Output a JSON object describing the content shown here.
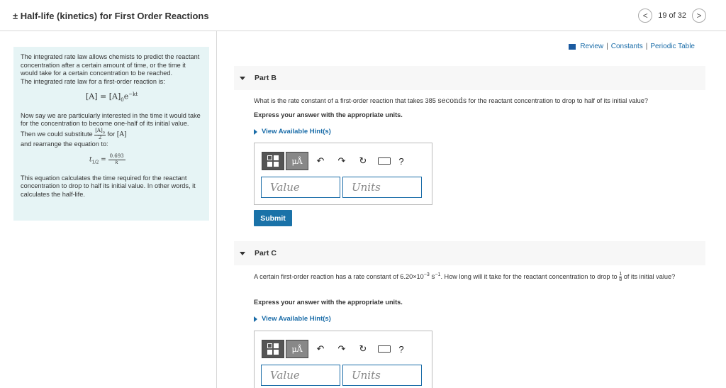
{
  "header": {
    "title": "± Half-life (kinetics) for First Order Reactions",
    "nav_prev": "<",
    "nav_position": "19 of 32",
    "nav_next": ">"
  },
  "intro": {
    "p1": "The integrated rate law allows chemists to predict the reactant concentration after a certain amount of time, or the time it would take for a certain concentration to be reached.",
    "p2": "The integrated rate law for a first-order reaction is:",
    "eq1_main": "[A] = [A]",
    "eq1_sub": "0",
    "eq1_e": "e",
    "eq1_exp": "−kt",
    "p3": "Now say we are particularly interested in the time it would take for the concentration to become one-half of its initial value. Then we could substitute",
    "subst_num": "[A]",
    "subst_num_sub": "0",
    "subst_den": "2",
    "p3_for": "for",
    "p3_A": "[A]",
    "p4": "and rearrange the equation to:",
    "eq2_lhs": "t",
    "eq2_sub": "1/2",
    "eq2_eq": "=",
    "eq2_num": "0.693",
    "eq2_den": "k",
    "p5": "This equation calculates the time required for the reactant concentration to drop to half its initial value. In other words, it calculates the half-life."
  },
  "links": {
    "review": "Review",
    "sep1": "|",
    "constants": "Constants",
    "sep2": "|",
    "periodic": "Periodic Table"
  },
  "partB": {
    "label": "Part B",
    "question_pre": "What is the rate constant of a first-order reaction that takes 385",
    "question_unit": "seconds",
    "question_post": "for the reactant concentration to drop to half of its initial value?",
    "express": "Express your answer with the appropriate units.",
    "hint": "View Available Hint(s)",
    "value_placeholder": "Value",
    "units_placeholder": "Units",
    "submit": "Submit"
  },
  "partC": {
    "label": "Part C",
    "question_pre": "A certain first-order reaction has a rate constant of 6.20×10",
    "question_exp": "−3",
    "question_unit": "s",
    "question_unit_exp": "−1",
    "question_mid": ". How long will it take for the reactant concentration to drop to",
    "frac_num": "1",
    "frac_den": "8",
    "question_post": "of its initial value?",
    "express": "Express your answer with the appropriate units.",
    "hint": "View Available Hint(s)",
    "value_placeholder": "Value",
    "units_placeholder": "Units"
  },
  "toolbar": {
    "mu": "μÅ",
    "undo": "↶",
    "redo": "↷",
    "reset": "↻",
    "help": "?"
  },
  "icons": [
    "template-icon",
    "mu-angstrom-icon",
    "undo-icon",
    "redo-icon",
    "reset-icon",
    "keyboard-icon",
    "help-icon"
  ],
  "colors": {
    "accent": "#1a6ca8",
    "intro_bg": "#e6f4f5",
    "submit_bg": "#1a72a8"
  }
}
